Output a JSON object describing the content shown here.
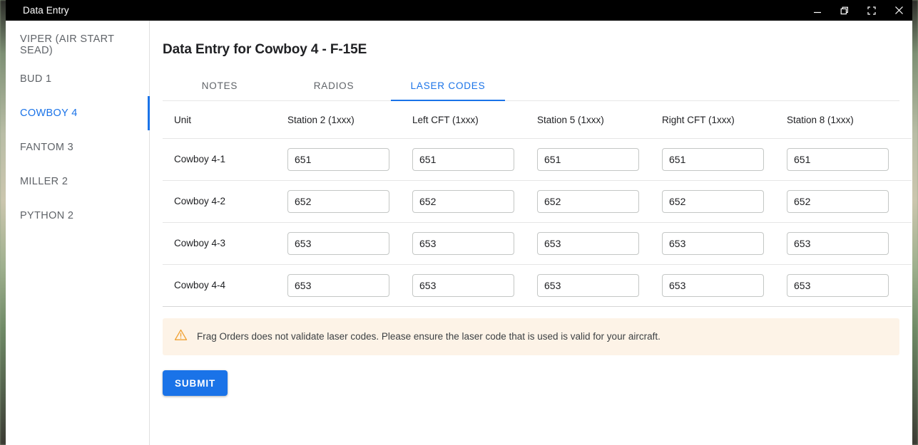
{
  "window": {
    "title": "Data Entry",
    "controls": [
      {
        "name": "minimize",
        "label": "Minimize"
      },
      {
        "name": "restore",
        "label": "Restore"
      },
      {
        "name": "fullscreen",
        "label": "Fullscreen"
      },
      {
        "name": "close",
        "label": "Close"
      }
    ]
  },
  "sidebar": {
    "items": [
      {
        "label": "VIPER (AIR START SEAD)",
        "active": false
      },
      {
        "label": "BUD 1",
        "active": false
      },
      {
        "label": "COWBOY 4",
        "active": true
      },
      {
        "label": "FANTOM 3",
        "active": false
      },
      {
        "label": "MILLER 2",
        "active": false
      },
      {
        "label": "PYTHON 2",
        "active": false
      }
    ]
  },
  "main": {
    "page_title": "Data Entry for Cowboy 4 - F-15E",
    "tabs": [
      {
        "label": "NOTES",
        "active": false
      },
      {
        "label": "RADIOS",
        "active": false
      },
      {
        "label": "LASER CODES",
        "active": true
      }
    ],
    "table": {
      "columns": [
        "Unit",
        "Station 2 (1xxx)",
        "Left CFT (1xxx)",
        "Station 5 (1xxx)",
        "Right CFT (1xxx)",
        "Station 8 (1xxx)"
      ],
      "rows": [
        {
          "unit": "Cowboy 4-1",
          "values": [
            "651",
            "651",
            "651",
            "651",
            "651"
          ]
        },
        {
          "unit": "Cowboy 4-2",
          "values": [
            "652",
            "652",
            "652",
            "652",
            "652"
          ]
        },
        {
          "unit": "Cowboy 4-3",
          "values": [
            "653",
            "653",
            "653",
            "653",
            "653"
          ]
        },
        {
          "unit": "Cowboy 4-4",
          "values": [
            "653",
            "653",
            "653",
            "653",
            "653"
          ]
        }
      ]
    },
    "warning": {
      "icon": "warning-triangle-icon",
      "text": "Frag Orders does not validate laser codes. Please ensure the laser code that is used is valid for your aircraft."
    },
    "submit_label": "SUBMIT"
  },
  "colors": {
    "accent": "#1a73e8",
    "titlebar_bg": "#000000",
    "warning_bg": "#fdf3e7",
    "warning_icon": "#f0a133",
    "text_muted": "#5f6368",
    "text_primary": "#202124",
    "divider": "#e6e6e6"
  }
}
